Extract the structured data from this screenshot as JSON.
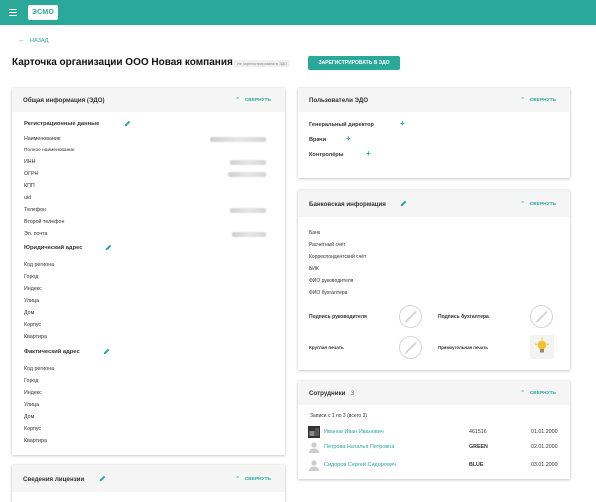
{
  "header": {
    "logo_text": "ЭСМО"
  },
  "nav": {
    "back_label": "НАЗАД",
    "back_icon": "arrow-left"
  },
  "page": {
    "title": "Карточка организации ООО Новая компания",
    "status_badge": "Не зарегистрирована в ЭДО",
    "register_button": "ЗАРЕГИСТРИРОВАТЬ В ЭДО"
  },
  "general": {
    "title": "Общая информация (ЭДО)",
    "collapse_label": "СВЕРНУТЬ",
    "reg_section": "Регистрационные данные",
    "reg_fields": [
      "Наименование",
      "Полное наименование",
      "ИНН",
      "ОГРН",
      "КПП",
      "uid",
      "Телефон",
      "Второй телефон",
      "Эл. почта"
    ],
    "legal_section": "Юридический адрес",
    "legal_fields": [
      "Код региона",
      "Город",
      "Индекс",
      "Улица",
      "Дом",
      "Корпус",
      "Квартира"
    ],
    "actual_section": "Фактический адрес",
    "actual_fields": [
      "Код региона",
      "Город",
      "Индекс",
      "Улица",
      "Дом",
      "Корпус",
      "Квартира"
    ]
  },
  "license": {
    "title": "Сведения лицензии",
    "collapse_label": "СВЕРНУТЬ"
  },
  "users": {
    "title": "Пользователи ЭДО",
    "collapse_label": "СВЕРНУТЬ",
    "roles": [
      "Генеральный директор",
      "Врачи",
      "Контролёры"
    ]
  },
  "bank": {
    "title": "Банковская информация",
    "collapse_label": "СВЕРНУТЬ",
    "fields": [
      "Банк",
      "Расчетный счёт",
      "Корреспондентский счёт",
      "БИК",
      "ФИО руководителя",
      "ФИО бухгалтера"
    ],
    "head_signature": "Подпись руководителя",
    "accountant_signature": "Подпись бухгалтера",
    "round_stamp": "Круглая печать",
    "rect_stamp": "Прямоугольная печать"
  },
  "employees": {
    "title": "Сотрудники",
    "count": "3",
    "collapse_label": "СВЕРНУТЬ",
    "records_info": "Записи с 1 по 3 (всего 3)",
    "rows": [
      {
        "name": "Иванов Иван Иванович",
        "code": "461516",
        "date": "01.01.2000"
      },
      {
        "name": "Петрова Наталья Петровна",
        "code": "GREEN",
        "date": "02.01.2000"
      },
      {
        "name": "Сидоров Сергей Сидорович",
        "code": "BLUE",
        "date": "03.01.2000"
      }
    ]
  },
  "colors": {
    "accent": "#2aa89a",
    "header_bg": "#2aa89a",
    "card_head_bg": "#f5f5f5"
  }
}
